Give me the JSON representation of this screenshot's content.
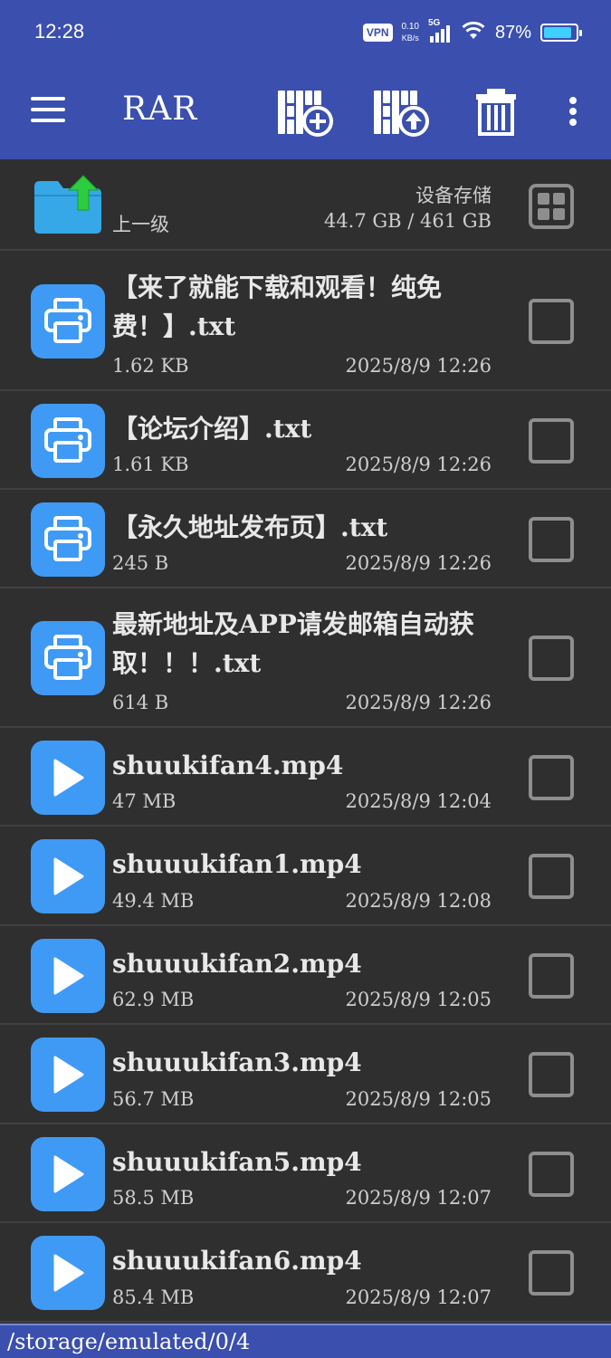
{
  "status_bar": {
    "time": "12:28",
    "vpn": "VPN",
    "net_speed_value": "0.10",
    "net_speed_unit": "KB/s",
    "network_type": "5G",
    "battery_percent": "87%",
    "battery_level": 0.87
  },
  "toolbar": {
    "title": "RAR",
    "icons": [
      "menu-icon",
      "add-to-archive-icon",
      "extract-icon",
      "delete-icon",
      "more-icon"
    ]
  },
  "header": {
    "up_label": "上一级",
    "storage_label": "设备存储",
    "storage_size": "44.7 GB / 461 GB"
  },
  "files": [
    {
      "type": "text",
      "name": "【来了就能下载和观看！纯免费！】.txt",
      "size": "1.62 KB",
      "date": "2025/8/9 12:26"
    },
    {
      "type": "text",
      "name": "【论坛介绍】.txt",
      "size": "1.61 KB",
      "date": "2025/8/9 12:26"
    },
    {
      "type": "text",
      "name": "【永久地址发布页】.txt",
      "size": "245 B",
      "date": "2025/8/9 12:26"
    },
    {
      "type": "text",
      "name": "最新地址及APP请发邮箱自动获取！！！.txt",
      "size": "614 B",
      "date": "2025/8/9 12:26"
    },
    {
      "type": "video",
      "name": "shuukifan4.mp4",
      "size": "47 MB",
      "date": "2025/8/9 12:04"
    },
    {
      "type": "video",
      "name": "shuuukifan1.mp4",
      "size": "49.4 MB",
      "date": "2025/8/9 12:08"
    },
    {
      "type": "video",
      "name": "shuuukifan2.mp4",
      "size": "62.9 MB",
      "date": "2025/8/9 12:05"
    },
    {
      "type": "video",
      "name": "shuuukifan3.mp4",
      "size": "56.7 MB",
      "date": "2025/8/9 12:05"
    },
    {
      "type": "video",
      "name": "shuuukifan5.mp4",
      "size": "58.5 MB",
      "date": "2025/8/9 12:07"
    },
    {
      "type": "video",
      "name": "shuuukifan6.mp4",
      "size": "85.4 MB",
      "date": "2025/8/9 12:07"
    }
  ],
  "path_bar": {
    "path": "/storage/emulated/0/4"
  },
  "colors": {
    "accent": "#3a4fae",
    "background": "#2f2f2f",
    "thumb": "#3f9af5",
    "folder": "#36a8e8",
    "up_arrow": "#2ecc40"
  }
}
